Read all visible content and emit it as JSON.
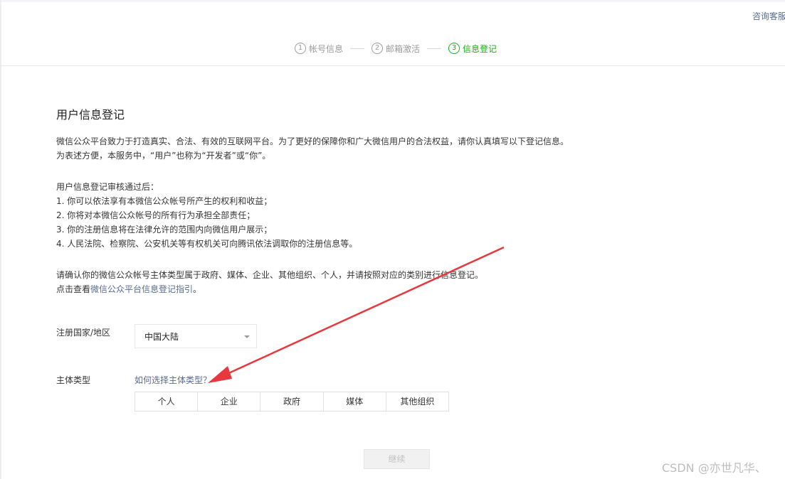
{
  "header": {
    "help_link": "咨询客服",
    "steps": [
      {
        "num": "1",
        "label": "帐号信息",
        "active": false
      },
      {
        "num": "2",
        "label": "邮箱激活",
        "active": false
      },
      {
        "num": "3",
        "label": "信息登记",
        "active": true
      }
    ]
  },
  "main": {
    "title": "用户信息登记",
    "intro": [
      "微信公众平台致力于打造真实、合法、有效的互联网平台。为了更好的保障你和广大微信用户的合法权益，请你认真填写以下登记信息。",
      "为表述方便，本服务中，“用户”也称为“开发者”或“你”。"
    ],
    "benefits": [
      "用户信息登记审核通过后：",
      "1. 你可以依法享有本微信公众帐号所产生的权利和收益；",
      "2. 你将对本微信公众帐号的所有行为承担全部责任；",
      "3. 你的注册信息将在法律允许的范围内向微信用户展示；",
      "4. 人民法院、检察院、公安机关等有权机关可向腾讯依法调取你的注册信息等。"
    ],
    "confirm_text": "请确认你的微信公众帐号主体类型属于政府、媒体、企业、其他组织、个人，并请按照对应的类别进行信息登记。",
    "guide_prefix": "点击查看",
    "guide_link": "微信公众平台信息登记指引",
    "guide_suffix": "。"
  },
  "form": {
    "country_label": "注册国家/地区",
    "country_value": "中国大陆",
    "subject_label": "主体类型",
    "subject_help": "如何选择主体类型？",
    "subject_types": [
      "个人",
      "企业",
      "政府",
      "媒体",
      "其他组织"
    ]
  },
  "actions": {
    "continue": "继续"
  },
  "watermark": "CSDN @亦世凡华、",
  "colors": {
    "accent_green": "#1aad19",
    "link_blue": "#576b95",
    "annotation_red": "#e8383d"
  }
}
